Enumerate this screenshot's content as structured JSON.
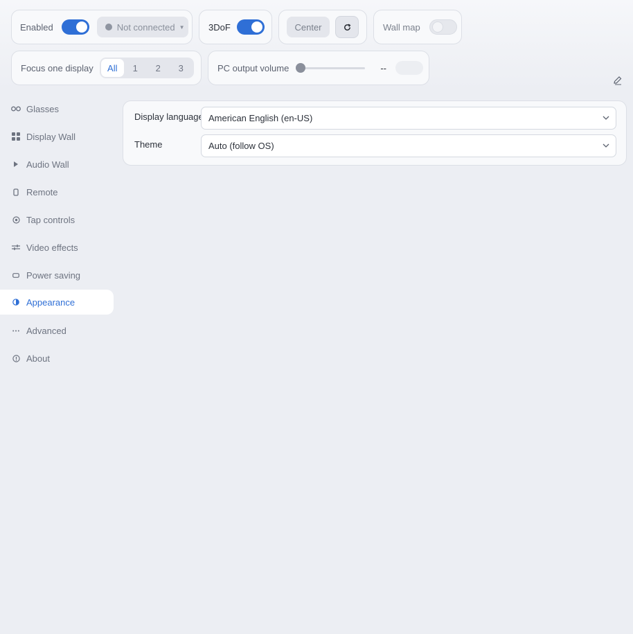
{
  "toolbar": {
    "enabled_label": "Enabled",
    "enabled_on": true,
    "connection_status": "Not connected",
    "dof_label": "3DoF",
    "dof_on": true,
    "center_label": "Center",
    "wallmap_label": "Wall map",
    "wallmap_on": false,
    "focus_label": "Focus one display",
    "focus_options": [
      "All",
      "1",
      "2",
      "3"
    ],
    "focus_selected": "All",
    "volume_label": "PC output volume",
    "volume_value": "--",
    "volume_level": 0
  },
  "sidebar": {
    "items": [
      {
        "label": "Glasses",
        "icon": "glasses-icon"
      },
      {
        "label": "Display Wall",
        "icon": "grid-icon"
      },
      {
        "label": "Audio Wall",
        "icon": "play-icon"
      },
      {
        "label": "Remote",
        "icon": "remote-icon"
      },
      {
        "label": "Tap controls",
        "icon": "target-icon"
      },
      {
        "label": "Video effects",
        "icon": "sliders-icon"
      },
      {
        "label": "Power saving",
        "icon": "battery-icon"
      },
      {
        "label": "Appearance",
        "icon": "contrast-icon"
      },
      {
        "label": "Advanced",
        "icon": "more-icon"
      },
      {
        "label": "About",
        "icon": "info-icon"
      }
    ],
    "active": "Appearance"
  },
  "appearance": {
    "language_label": "Display language",
    "language_value": "American English (en-US)",
    "theme_label": "Theme",
    "theme_value": "Auto (follow OS)"
  },
  "colors": {
    "accent": "#2f6fd6",
    "background": "#eceef3",
    "card": "#f8f9fb"
  }
}
